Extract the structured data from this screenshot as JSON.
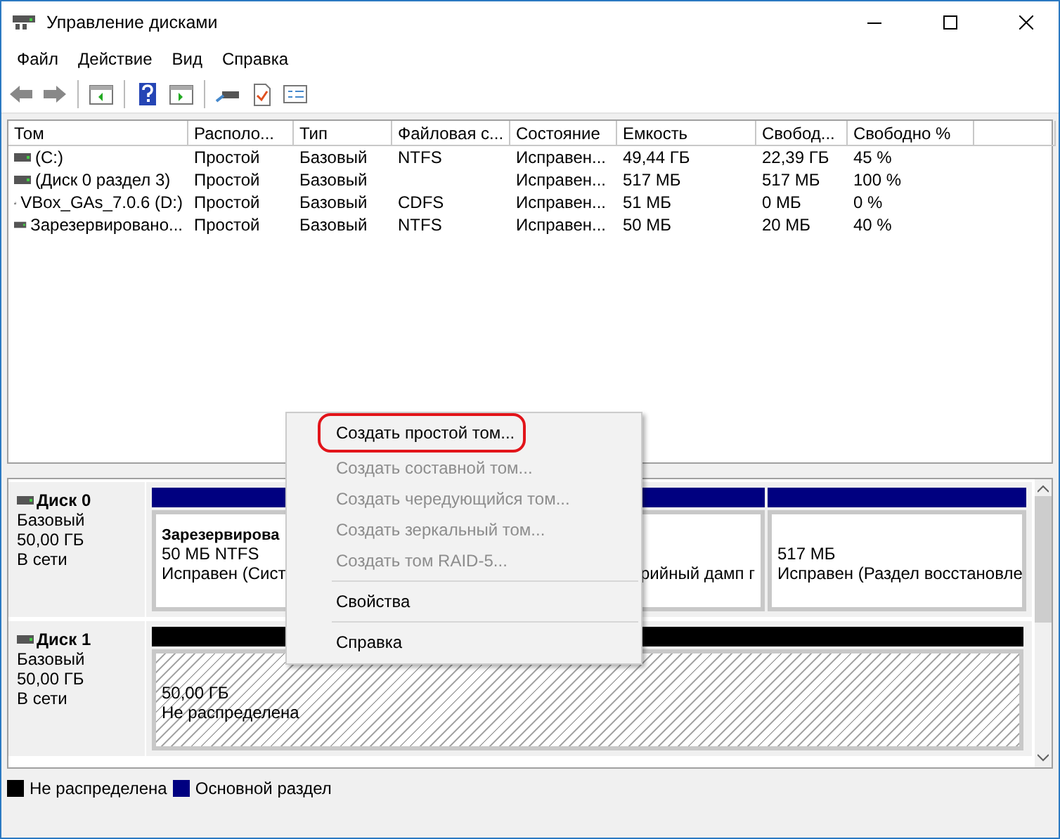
{
  "window": {
    "title": "Управление дисками"
  },
  "menu": [
    "Файл",
    "Действие",
    "Вид",
    "Справка"
  ],
  "table": {
    "columns": [
      "Том",
      "Располо...",
      "Тип",
      "Файловая с...",
      "Состояние",
      "Емкость",
      "Свобод...",
      "Свободно %"
    ],
    "rows": [
      {
        "kind": "drive",
        "cells": [
          "(C:)",
          "Простой",
          "Базовый",
          "NTFS",
          "Исправен...",
          "49,44 ГБ",
          "22,39 ГБ",
          "45 %"
        ]
      },
      {
        "kind": "drive",
        "cells": [
          "(Диск 0 раздел 3)",
          "Простой",
          "Базовый",
          "",
          "Исправен...",
          "517 МБ",
          "517 МБ",
          "100 %"
        ]
      },
      {
        "kind": "cdrom",
        "cells": [
          "VBox_GAs_7.0.6 (D:)",
          "Простой",
          "Базовый",
          "CDFS",
          "Исправен...",
          "51 МБ",
          "0 МБ",
          "0 %"
        ]
      },
      {
        "kind": "drive",
        "cells": [
          "Зарезервировано...",
          "Простой",
          "Базовый",
          "NTFS",
          "Исправен...",
          "50 МБ",
          "20 МБ",
          "40 %"
        ]
      }
    ]
  },
  "disks": [
    {
      "name": "Диск 0",
      "lines": [
        "Базовый",
        "50,00 ГБ",
        "В сети"
      ],
      "partitions": [
        {
          "kind": "primary",
          "title": "Зарезервирова",
          "lines": [
            "50 МБ NTFS",
            "Исправен (Сист"
          ]
        },
        {
          "kind": "primary",
          "lines": [
            "рийный дамп г"
          ]
        },
        {
          "kind": "primary",
          "lines": [
            "517 МБ",
            "Исправен (Раздел восстановле"
          ]
        }
      ]
    },
    {
      "name": "Диск 1",
      "lines": [
        "Базовый",
        "50,00 ГБ",
        "В сети"
      ],
      "partitions": [
        {
          "kind": "unallocated",
          "lines": [
            "50,00 ГБ",
            "Не распределена"
          ]
        }
      ]
    }
  ],
  "legend": [
    {
      "label": "Не распределена",
      "color": "#000000"
    },
    {
      "label": "Основной раздел",
      "color": "#000080"
    }
  ],
  "context_menu": [
    {
      "kind": "item",
      "label": "Создать простой том...",
      "disabled": false,
      "annotated": true
    },
    {
      "kind": "item",
      "label": "Создать составной том...",
      "disabled": true,
      "annotated": false
    },
    {
      "kind": "item",
      "label": "Создать чередующийся том...",
      "disabled": true,
      "annotated": false
    },
    {
      "kind": "item",
      "label": "Создать зеркальный том...",
      "disabled": true,
      "annotated": false
    },
    {
      "kind": "item",
      "label": "Создать том RAID-5...",
      "disabled": true,
      "annotated": false
    },
    {
      "kind": "separator"
    },
    {
      "kind": "item",
      "label": "Свойства",
      "disabled": false,
      "annotated": false
    },
    {
      "kind": "separator"
    },
    {
      "kind": "item",
      "label": "Справка",
      "disabled": false,
      "annotated": false
    }
  ]
}
